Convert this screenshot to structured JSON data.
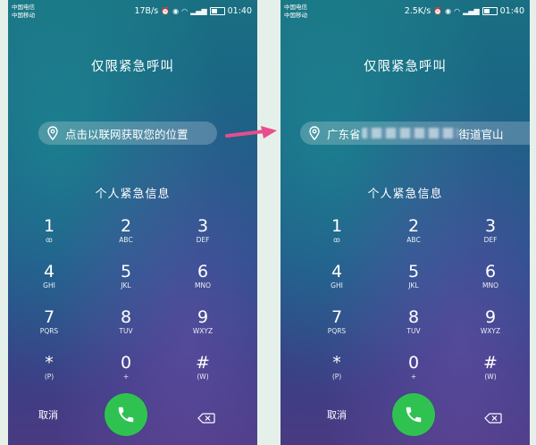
{
  "screens": [
    {
      "status": {
        "carrier1": "中国电信",
        "carrier2": "中国移动",
        "net_speed": "17B/s",
        "time": "01:40"
      },
      "title": "仅限紧急呼叫",
      "location_text": "点击以联网获取您的位置",
      "info_label": "个人紧急信息",
      "cancel_label": "取消"
    },
    {
      "status": {
        "carrier1": "中国电信",
        "carrier2": "中国移动",
        "net_speed": "2.5K/s",
        "time": "01:40"
      },
      "title": "仅限紧急呼叫",
      "location_prefix": "广东省",
      "location_suffix": "街道官山",
      "info_label": "个人紧急信息",
      "cancel_label": "取消"
    }
  ],
  "keys": [
    {
      "d": "1",
      "l": "ꝏ"
    },
    {
      "d": "2",
      "l": "ABC"
    },
    {
      "d": "3",
      "l": "DEF"
    },
    {
      "d": "4",
      "l": "GHI"
    },
    {
      "d": "5",
      "l": "JKL"
    },
    {
      "d": "6",
      "l": "MNO"
    },
    {
      "d": "7",
      "l": "PQRS"
    },
    {
      "d": "8",
      "l": "TUV"
    },
    {
      "d": "9",
      "l": "WXYZ"
    },
    {
      "d": "*",
      "l": "(P)"
    },
    {
      "d": "0",
      "l": "+"
    },
    {
      "d": "#",
      "l": "(W)"
    }
  ],
  "icons": {
    "location": "location-pin-icon",
    "call": "phone-icon",
    "delete": "backspace-icon",
    "arrow": "arrow-right-icon"
  },
  "colors": {
    "call_button": "#2fc251",
    "arrow": "#e64e8c"
  }
}
